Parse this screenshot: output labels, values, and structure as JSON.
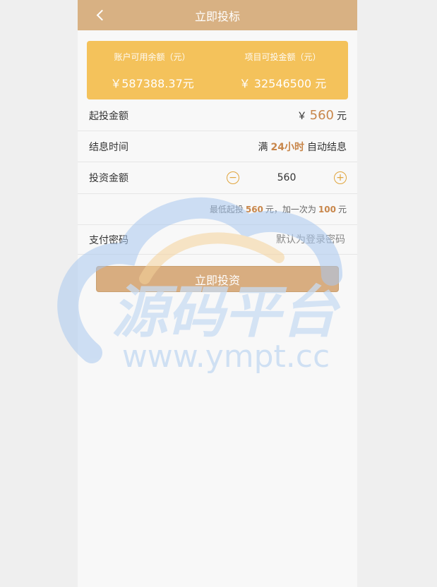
{
  "header": {
    "title": "立即投标"
  },
  "balance": {
    "account_label": "账户可用余额（元）",
    "account_value": "￥587388.37元",
    "project_label": "项目可投金额（元）",
    "project_value": "￥ 32546500 元"
  },
  "min_invest": {
    "label": "起投金额",
    "prefix": "￥",
    "amount": "560",
    "unit": "元"
  },
  "interest": {
    "label": "结息时间",
    "prefix": "满",
    "hours": "24小时",
    "suffix": "自动结息"
  },
  "invest_amount": {
    "label": "投资金额",
    "minus": "−",
    "value": "560",
    "plus": "+"
  },
  "hint": {
    "t1": "最低起投",
    "min": "560",
    "t2": "元，加一次为",
    "step": "100",
    "t3": "元"
  },
  "password": {
    "label": "支付密码",
    "placeholder": "默认为登录密码"
  },
  "submit": {
    "label": "立即投资"
  },
  "watermark": {
    "logo_text": "源码平台",
    "url": "www.ympt.cc"
  },
  "colors": {
    "header": "#d8b183",
    "card": "#f4c25b",
    "accent": "#c8864a"
  }
}
